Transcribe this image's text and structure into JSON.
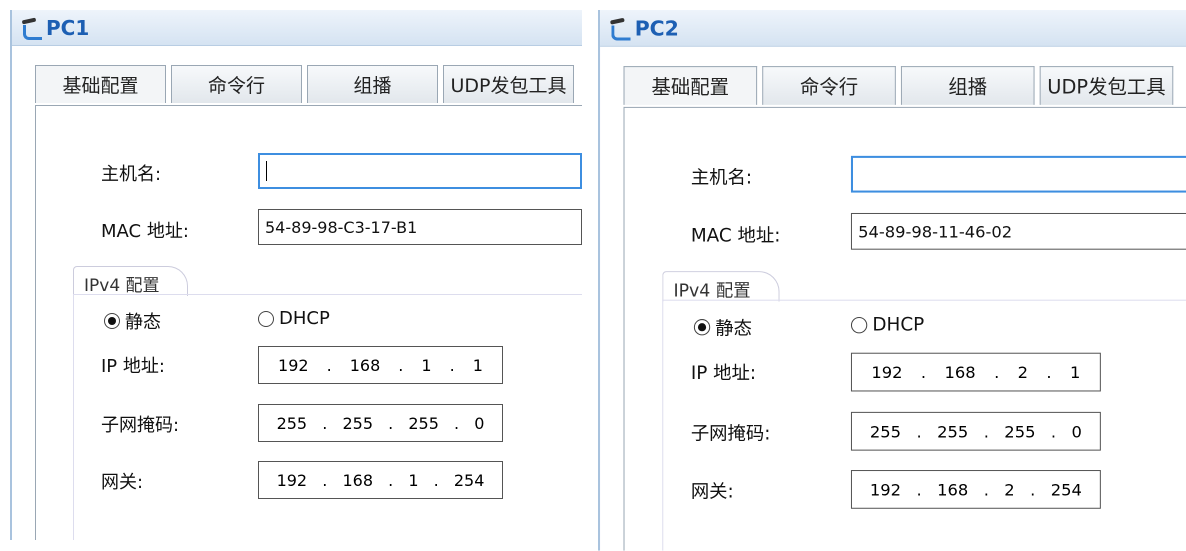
{
  "panels": [
    {
      "title": "PC1",
      "tabs": [
        "基础配置",
        "命令行",
        "组播",
        "UDP发包工具"
      ],
      "hostname_label": "主机名:",
      "hostname_value": "",
      "mac_label": "MAC 地址:",
      "mac_value": "54-89-98-C3-17-B1",
      "ipv4_group": "IPv4 配置",
      "static_label": "静态",
      "dhcp_label": "DHCP",
      "ip_label": "IP 地址:",
      "ip": [
        "192",
        "168",
        "1",
        "1"
      ],
      "mask_label": "子网掩码:",
      "mask": [
        "255",
        "255",
        "255",
        "0"
      ],
      "gw_label": "网关:",
      "gw": [
        "192",
        "168",
        "1",
        "254"
      ]
    },
    {
      "title": "PC2",
      "tabs": [
        "基础配置",
        "命令行",
        "组播",
        "UDP发包工具"
      ],
      "hostname_label": "主机名:",
      "hostname_value": "",
      "mac_label": "MAC 地址:",
      "mac_value": "54-89-98-11-46-02",
      "ipv4_group": "IPv4 配置",
      "static_label": "静态",
      "dhcp_label": "DHCP",
      "ip_label": "IP 地址:",
      "ip": [
        "192",
        "168",
        "2",
        "1"
      ],
      "mask_label": "子网掩码:",
      "mask": [
        "255",
        "255",
        "255",
        "0"
      ],
      "gw_label": "网关:",
      "gw": [
        "192",
        "168",
        "2",
        "254"
      ]
    }
  ]
}
